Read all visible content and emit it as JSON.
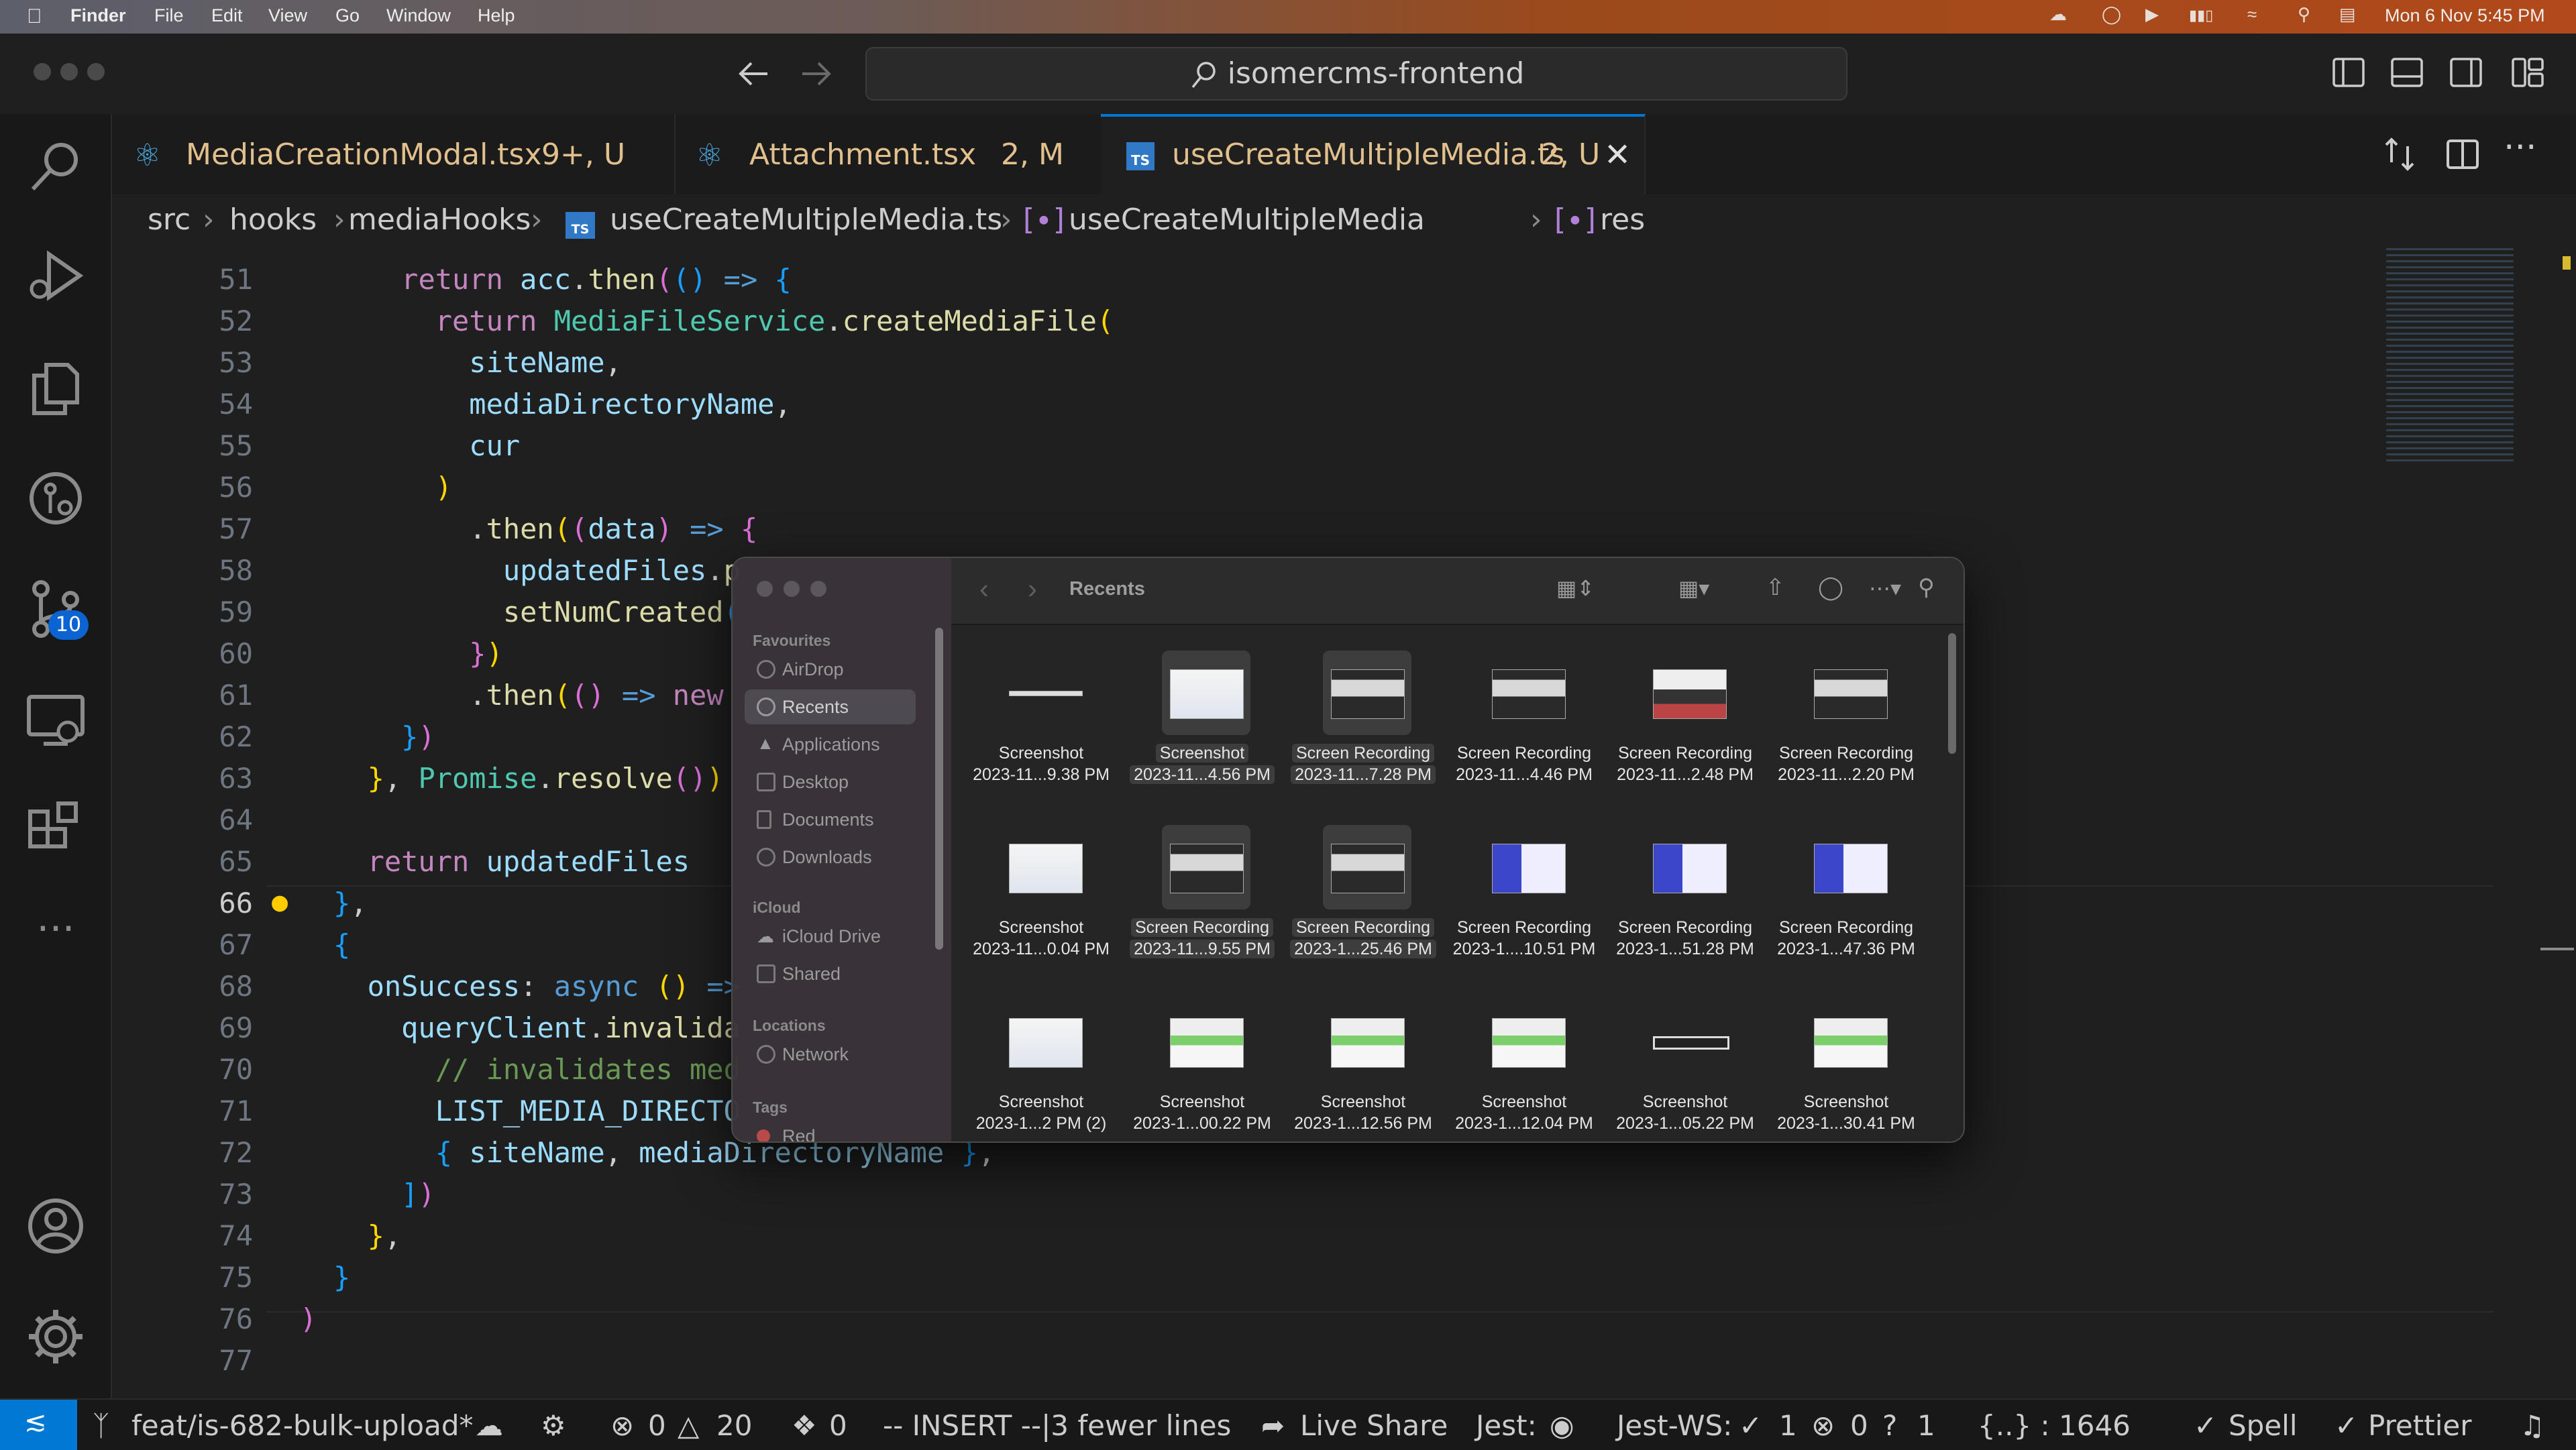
{
  "menubar": {
    "app": "Finder",
    "items": [
      "File",
      "Edit",
      "View",
      "Go",
      "Window",
      "Help"
    ],
    "datetime": "Mon 6 Nov  5:45 PM"
  },
  "titlebar": {
    "search_text": "isomercms-frontend"
  },
  "activity": {
    "source_control_badge": "10"
  },
  "tabs": [
    {
      "label": "MediaCreationModal.tsx",
      "status": "9+, U"
    },
    {
      "label": "Attachment.tsx",
      "status": "2, M"
    },
    {
      "label": "useCreateMultipleMedia.ts",
      "status": "2, U"
    }
  ],
  "breadcrumbs": [
    "src",
    "hooks",
    "mediaHooks",
    "useCreateMultipleMedia.ts",
    "useCreateMultipleMedia",
    "res"
  ],
  "editor": {
    "line_numbers": [
      "51",
      "52",
      "53",
      "54",
      "55",
      "56",
      "57",
      "58",
      "59",
      "60",
      "61",
      "62",
      "63",
      "64",
      "65",
      "66",
      "67",
      "68",
      "69",
      "70",
      "71",
      "72",
      "73",
      "74",
      "75",
      "76",
      "77"
    ]
  },
  "finder": {
    "location": "Recents",
    "sidebar": {
      "favourites_heading": "Favourites",
      "favourites": [
        "AirDrop",
        "Recents",
        "Applications",
        "Desktop",
        "Documents",
        "Downloads"
      ],
      "icloud_heading": "iCloud",
      "icloud": [
        "iCloud Drive",
        "Shared"
      ],
      "locations_heading": "Locations",
      "locations": [
        "Network"
      ],
      "tags_heading": "Tags",
      "tags": [
        "Red"
      ]
    },
    "items": [
      {
        "name": "Screenshot",
        "date": "2023-11...9.38 PM",
        "selected": false
      },
      {
        "name": "Screenshot",
        "date": "2023-11...4.56 PM",
        "selected": true
      },
      {
        "name": "Screen Recording",
        "date": "2023-11...7.28 PM",
        "selected": true
      },
      {
        "name": "Screen Recording",
        "date": "2023-11...4.46 PM",
        "selected": false
      },
      {
        "name": "Screen Recording",
        "date": "2023-11...2.48 PM",
        "selected": false
      },
      {
        "name": "Screen Recording",
        "date": "2023-11...2.20 PM",
        "selected": false
      },
      {
        "name": "Screenshot",
        "date": "2023-11...0.04 PM",
        "selected": false
      },
      {
        "name": "Screen Recording",
        "date": "2023-11...9.55 PM",
        "selected": true
      },
      {
        "name": "Screen Recording",
        "date": "2023-1...25.46 PM",
        "selected": true
      },
      {
        "name": "Screen Recording",
        "date": "2023-1....10.51 PM",
        "selected": false
      },
      {
        "name": "Screen Recording",
        "date": "2023-1...51.28 PM",
        "selected": false
      },
      {
        "name": "Screen Recording",
        "date": "2023-1...47.36 PM",
        "selected": false
      },
      {
        "name": "Screenshot",
        "date": "2023-1...2 PM (2)",
        "selected": false
      },
      {
        "name": "Screenshot",
        "date": "2023-1...00.22 PM",
        "selected": false
      },
      {
        "name": "Screenshot",
        "date": "2023-1...12.56 PM",
        "selected": false
      },
      {
        "name": "Screenshot",
        "date": "2023-1...12.04 PM",
        "selected": false
      },
      {
        "name": "Screenshot",
        "date": "2023-1...05.22 PM",
        "selected": false
      },
      {
        "name": "Screenshot",
        "date": "2023-1...30.41 PM",
        "selected": false
      }
    ]
  },
  "status": {
    "branch": "feat/is-682-bulk-upload*",
    "errors": "0",
    "warnings": "20",
    "ports": "0",
    "mode": "-- INSERT --|3 fewer lines",
    "live_share": "Live Share",
    "jest": "Jest:",
    "jest_ws": "Jest-WS:",
    "jest_pass": "1",
    "jest_fail": "0",
    "jest_unknown": "1",
    "cursor": "{..} : 1646",
    "spell": "Spell",
    "prettier": "Prettier"
  },
  "colors": {
    "accent": "#0078d4",
    "tab_modified": "#e2c08d",
    "editor_bg": "#1f1f1f"
  }
}
